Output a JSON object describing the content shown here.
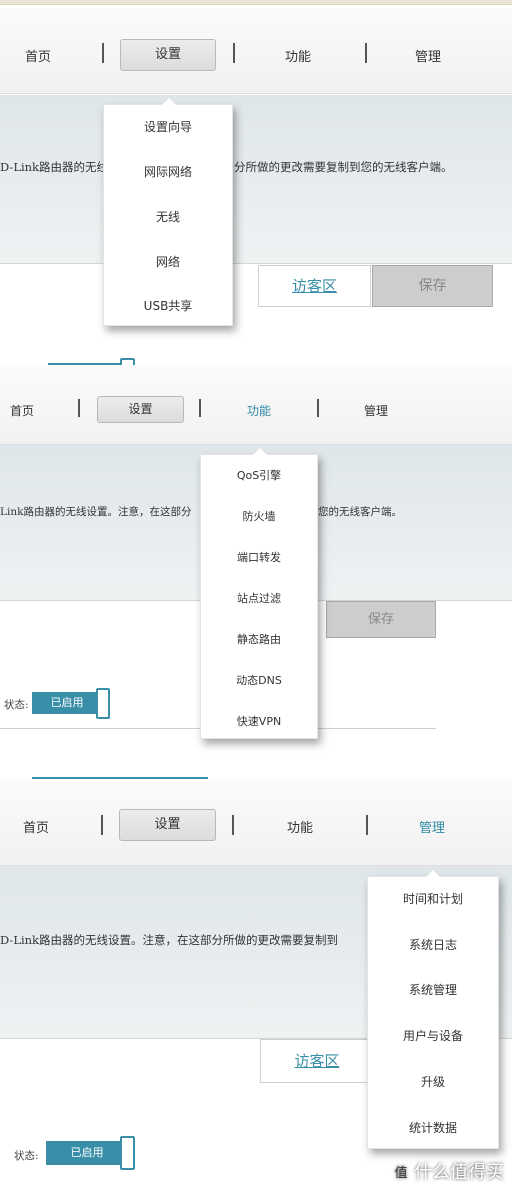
{
  "panel1": {
    "nav": {
      "home": "首页",
      "settings": "设置",
      "features": "功能",
      "management": "管理"
    },
    "intro_left": "D-Link路由器的无线",
    "intro_right": "分所做的更改需要复制到您的无线客户端。",
    "guest_zone": "访客区",
    "save": "保存",
    "dropdown": [
      "设置向导",
      "网际网络",
      "无线",
      "网络",
      "USB共享"
    ]
  },
  "panel2": {
    "nav": {
      "home": "首页",
      "settings": "设置",
      "features": "功能",
      "management": "管理"
    },
    "intro_left": "Link路由器的无线设置。注意，在这部分",
    "intro_right": "您的无线客户端。",
    "save": "保存",
    "status_label": "状态:",
    "status_value": "已启用",
    "dropdown": [
      "QoS引擎",
      "防火墙",
      "端口转发",
      "站点过滤",
      "静态路由",
      "动态DNS",
      "快速VPN"
    ]
  },
  "panel3": {
    "nav": {
      "home": "首页",
      "settings": "设置",
      "features": "功能",
      "management": "管理"
    },
    "intro_left": "D-Link路由器的无线设置。注意，在这部分所做的更改需要复制到",
    "guest_zone": "访客区",
    "status_label": "状态:",
    "status_value": "已启用",
    "dropdown": [
      "时间和计划",
      "系统日志",
      "系统管理",
      "用户与设备",
      "升级",
      "统计数据"
    ]
  },
  "watermark": {
    "icon": "值",
    "text": "什么值得买"
  },
  "colors": {
    "accent": "#3a8fa8",
    "content_bg": "#e6ecee"
  }
}
